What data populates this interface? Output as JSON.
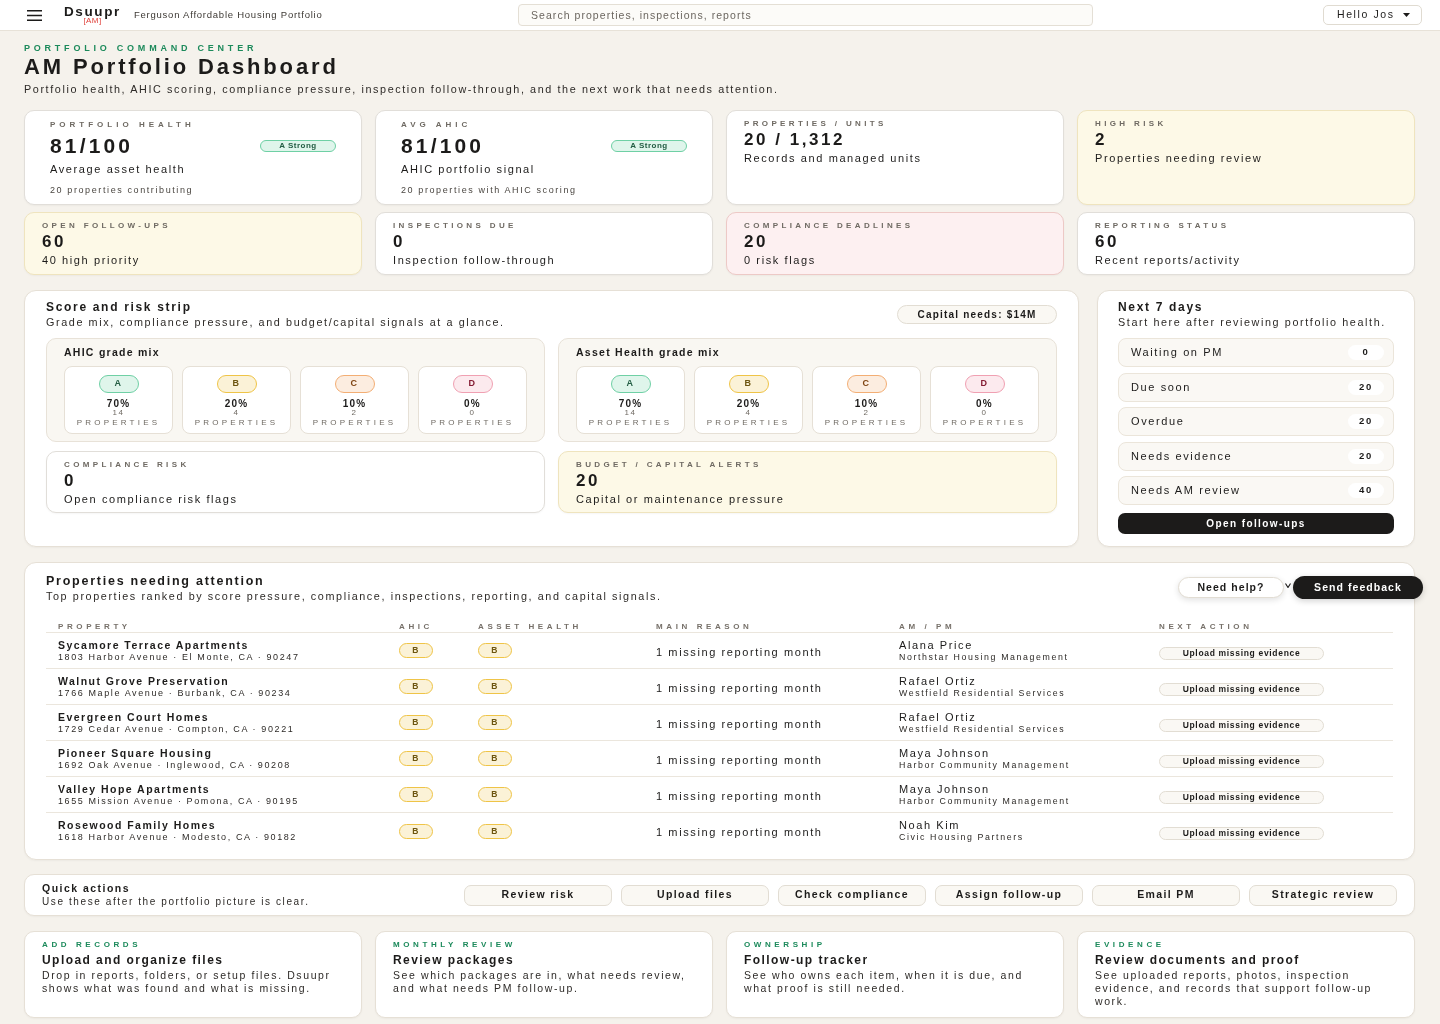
{
  "header": {
    "brand": "Dsuupr",
    "brand_tag": "[AM]",
    "portfolio": "Ferguson Affordable Housing Portfolio",
    "search": {
      "placeholder": "Search properties, inspections, reports"
    },
    "user_menu": "Hello Jos"
  },
  "page": {
    "eyebrow": "PORTFOLIO COMMAND CENTER",
    "title": "AM Portfolio Dashboard",
    "subtitle": "Portfolio health, AHIC scoring, compliance pressure, inspection follow-through, and the next work that needs attention."
  },
  "kpis": [
    {
      "kind": "score",
      "color": "#ffffff",
      "label": "PORTFOLIO HEALTH",
      "value": "81/100",
      "badge": {
        "text": "A Strong",
        "color": "#6fd0a5"
      },
      "caption": "Average asset health",
      "note": "20 properties contributing"
    },
    {
      "kind": "score",
      "color": "#ffffff",
      "label": "AVG AHIC",
      "value": "81/100",
      "badge": {
        "text": "A Strong",
        "color": "#6fd0a5"
      },
      "caption": "AHIC portfolio signal",
      "note": "20 properties with AHIC scoring"
    },
    {
      "kind": "stat",
      "color": "#ffffff",
      "label": "PROPERTIES / UNITS",
      "value": "20 / 1,312",
      "caption": "Records and managed units"
    },
    {
      "kind": "stat",
      "color": "#fdf9e7",
      "label": "HIGH RISK",
      "value": "2",
      "caption": "Properties needing review"
    },
    {
      "kind": "stat",
      "color": "#fdf9e7",
      "label": "OPEN FOLLOW-UPS",
      "value": "60",
      "caption": "40 high priority"
    },
    {
      "kind": "stat",
      "color": "#ffffff",
      "label": "INSPECTIONS DUE",
      "value": "0",
      "caption": "Inspection follow-through"
    },
    {
      "kind": "stat",
      "color": "#fdf0f1",
      "label": "COMPLIANCE DEADLINES",
      "value": "20",
      "caption": "0 risk flags"
    },
    {
      "kind": "stat",
      "color": "#ffffff",
      "label": "REPORTING STATUS",
      "value": "60",
      "caption": "Recent reports/activity"
    }
  ],
  "score_strip": {
    "title": "Score and risk strip",
    "subtitle": "Grade mix, compliance pressure, and budget/capital signals at a glance.",
    "capital_needs": "Capital needs: $14M",
    "grade_mixes": [
      {
        "title": "AHIC grade mix",
        "grades": [
          {
            "grade": "A",
            "color": "#6fd0a5",
            "percent": "70%",
            "count": "14",
            "unit": "PROPERTIES"
          },
          {
            "grade": "B",
            "color": "#efc447",
            "percent": "20%",
            "count": "4",
            "unit": "PROPERTIES"
          },
          {
            "grade": "C",
            "color": "#f3ae74",
            "percent": "10%",
            "count": "2",
            "unit": "PROPERTIES"
          },
          {
            "grade": "D",
            "color": "#f0a0b2",
            "percent": "0%",
            "count": "0",
            "unit": "PROPERTIES"
          }
        ]
      },
      {
        "title": "Asset Health grade mix",
        "grades": [
          {
            "grade": "A",
            "color": "#6fd0a5",
            "percent": "70%",
            "count": "14",
            "unit": "PROPERTIES"
          },
          {
            "grade": "B",
            "color": "#efc447",
            "percent": "20%",
            "count": "4",
            "unit": "PROPERTIES"
          },
          {
            "grade": "C",
            "color": "#f3ae74",
            "percent": "10%",
            "count": "2",
            "unit": "PROPERTIES"
          },
          {
            "grade": "D",
            "color": "#f0a0b2",
            "percent": "0%",
            "count": "0",
            "unit": "PROPERTIES"
          }
        ]
      }
    ],
    "risk_cards": [
      {
        "label": "COMPLIANCE RISK",
        "value": "0",
        "caption": "Open compliance risk flags",
        "color": "#ffffff"
      },
      {
        "label": "BUDGET / CAPITAL ALERTS",
        "value": "20",
        "caption": "Capital or maintenance pressure",
        "color": "#fdf9e7"
      }
    ]
  },
  "next_7_days": {
    "title": "Next 7 days",
    "subtitle": "Start here after reviewing portfolio health.",
    "items": [
      {
        "label": "Waiting on PM",
        "count": "0"
      },
      {
        "label": "Due soon",
        "count": "20"
      },
      {
        "label": "Overdue",
        "count": "20"
      },
      {
        "label": "Needs evidence",
        "count": "20"
      },
      {
        "label": "Needs AM review",
        "count": "40"
      }
    ],
    "button": "Open follow-ups"
  },
  "properties": {
    "title": "Properties needing attention",
    "subtitle": "Top properties ranked by score pressure, compliance, inspections, reporting, and capital signals.",
    "columns": [
      "PROPERTY",
      "AHIC",
      "ASSET HEALTH",
      "MAIN REASON",
      "AM / PM",
      "NEXT ACTION"
    ],
    "rows": [
      {
        "property": "Sycamore Terrace Apartments",
        "address": "1803 Harbor Avenue · El Monte, CA · 90247",
        "ahic": {
          "grade": "B",
          "color": "#efc447"
        },
        "asset_health": {
          "grade": "B",
          "color": "#efc447"
        },
        "main_reason": "1 missing reporting month",
        "am": "Alana Price",
        "pm": "Northstar Housing Management",
        "next_action": "Upload missing evidence"
      },
      {
        "property": "Walnut Grove Preservation",
        "address": "1766 Maple Avenue · Burbank, CA · 90234",
        "ahic": {
          "grade": "B",
          "color": "#efc447"
        },
        "asset_health": {
          "grade": "B",
          "color": "#efc447"
        },
        "main_reason": "1 missing reporting month",
        "am": "Rafael Ortiz",
        "pm": "Westfield Residential Services",
        "next_action": "Upload missing evidence"
      },
      {
        "property": "Evergreen Court Homes",
        "address": "1729 Cedar Avenue · Compton, CA · 90221",
        "ahic": {
          "grade": "B",
          "color": "#efc447"
        },
        "asset_health": {
          "grade": "B",
          "color": "#efc447"
        },
        "main_reason": "1 missing reporting month",
        "am": "Rafael Ortiz",
        "pm": "Westfield Residential Services",
        "next_action": "Upload missing evidence"
      },
      {
        "property": "Pioneer Square Housing",
        "address": "1692 Oak Avenue · Inglewood, CA · 90208",
        "ahic": {
          "grade": "B",
          "color": "#efc447"
        },
        "asset_health": {
          "grade": "B",
          "color": "#efc447"
        },
        "main_reason": "1 missing reporting month",
        "am": "Maya Johnson",
        "pm": "Harbor Community Management",
        "next_action": "Upload missing evidence"
      },
      {
        "property": "Valley Hope Apartments",
        "address": "1655 Mission Avenue · Pomona, CA · 90195",
        "ahic": {
          "grade": "B",
          "color": "#efc447"
        },
        "asset_health": {
          "grade": "B",
          "color": "#efc447"
        },
        "main_reason": "1 missing reporting month",
        "am": "Maya Johnson",
        "pm": "Harbor Community Management",
        "next_action": "Upload missing evidence"
      },
      {
        "property": "Rosewood Family Homes",
        "address": "1618 Harbor Avenue · Modesto, CA · 90182",
        "ahic": {
          "grade": "B",
          "color": "#efc447"
        },
        "asset_health": {
          "grade": "B",
          "color": "#efc447"
        },
        "main_reason": "1 missing reporting month",
        "am": "Noah Kim",
        "pm": "Civic Housing Partners",
        "next_action": "Upload missing evidence"
      }
    ]
  },
  "help_widget": {
    "help": "Need help?",
    "feedback": "Send feedback"
  },
  "quick_actions": {
    "title": "Quick actions",
    "subtitle": "Use these after the portfolio picture is clear.",
    "actions": [
      "Review risk",
      "Upload files",
      "Check compliance",
      "Assign follow-up",
      "Email PM",
      "Strategic review"
    ]
  },
  "shortcuts": [
    {
      "eyebrow": "ADD RECORDS",
      "title": "Upload and organize files",
      "description": "Drop in reports, folders, or setup files. Dsuupr shows what was found and what is missing."
    },
    {
      "eyebrow": "MONTHLY REVIEW",
      "title": "Review packages",
      "description": "See which packages are in, what needs review, and what needs PM follow-up."
    },
    {
      "eyebrow": "OWNERSHIP",
      "title": "Follow-up tracker",
      "description": "See who owns each item, when it is due, and what proof is still needed."
    },
    {
      "eyebrow": "EVIDENCE",
      "title": "Review documents and proof",
      "description": "See uploaded reports, photos, inspection evidence, and records that support follow-up work."
    }
  ]
}
